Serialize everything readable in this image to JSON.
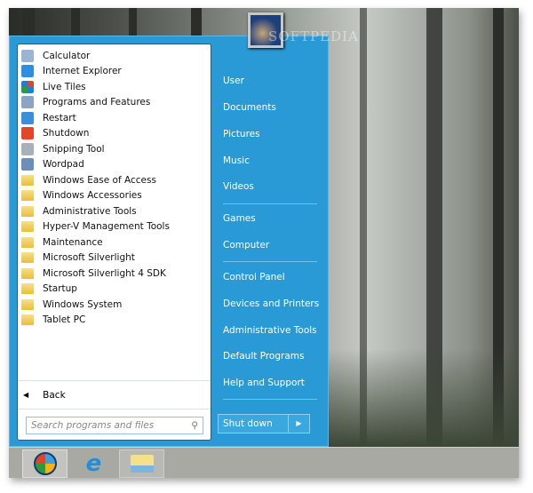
{
  "programs": [
    "Calculator",
    "Internet Explorer",
    "Live Tiles",
    "Programs and Features",
    "Restart",
    "Shutdown",
    "Snipping Tool",
    "Wordpad",
    "Windows Ease of Access",
    "Windows Accessories",
    "Administrative Tools",
    "Hyper-V Management Tools",
    "Maintenance",
    "Microsoft Silverlight",
    "Microsoft Silverlight 4 SDK",
    "Startup",
    "Windows System",
    "Tablet PC"
  ],
  "back_label": "Back",
  "search_placeholder": "Search programs and files",
  "right": [
    "User",
    "Documents",
    "Pictures",
    "Music",
    "Videos",
    "Games",
    "Computer",
    "Control Panel",
    "Devices and Printers",
    "Administrative Tools",
    "Default Programs",
    "Help and Support"
  ],
  "shutdown_label": "Shut down",
  "watermark": "SOFTPEDIA"
}
